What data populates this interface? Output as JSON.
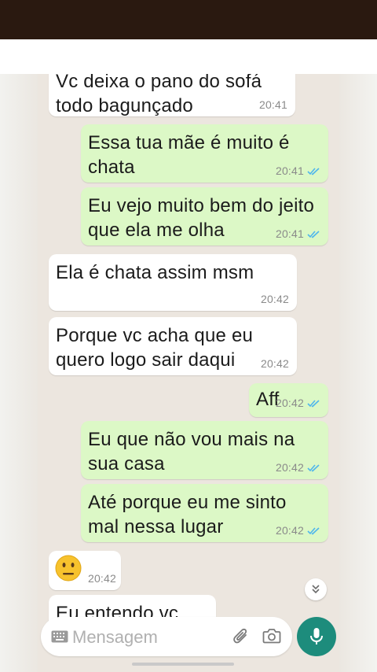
{
  "messages": [
    {
      "text": "Vc deixa o pano do sofá\ntodo bagunçado",
      "time": "20:41",
      "direction": "incoming"
    },
    {
      "text": "Essa tua mãe é muito é\nchata",
      "time": "20:41",
      "direction": "outgoing",
      "status": "read"
    },
    {
      "text": "Eu vejo muito bem do jeito\nque ela me olha",
      "time": "20:41",
      "direction": "outgoing",
      "status": "read"
    },
    {
      "text": "Ela é chata assim msm",
      "time": "20:42",
      "direction": "incoming"
    },
    {
      "text": "Porque vc acha que eu\nquero logo sair daqui",
      "time": "20:42",
      "direction": "incoming"
    },
    {
      "text": "Aff",
      "time": "20:42",
      "direction": "outgoing",
      "status": "read"
    },
    {
      "text": "Eu que não vou mais na\nsua casa",
      "time": "20:42",
      "direction": "outgoing",
      "status": "read"
    },
    {
      "text": "Até porque eu me sinto\nmal nessa lugar",
      "time": "20:42",
      "direction": "outgoing",
      "status": "read"
    },
    {
      "emoji": "neutral-face",
      "time": "20:42",
      "direction": "incoming"
    },
    {
      "text": "Eu entendo vc",
      "direction": "incoming"
    }
  ],
  "composer": {
    "placeholder": "Mensagem",
    "left_icon": "keyboard-icon",
    "icons": [
      "paperclip-icon",
      "camera-icon"
    ],
    "send_icon": "microphone-icon"
  },
  "colors": {
    "outgoing_bubble": "#dcf8c6",
    "incoming_bubble": "#ffffff",
    "chat_background": "#ece6df",
    "read_tick": "#4fb6ec",
    "mic_button": "#1d8c7c",
    "top_bar": "#2a1910"
  }
}
